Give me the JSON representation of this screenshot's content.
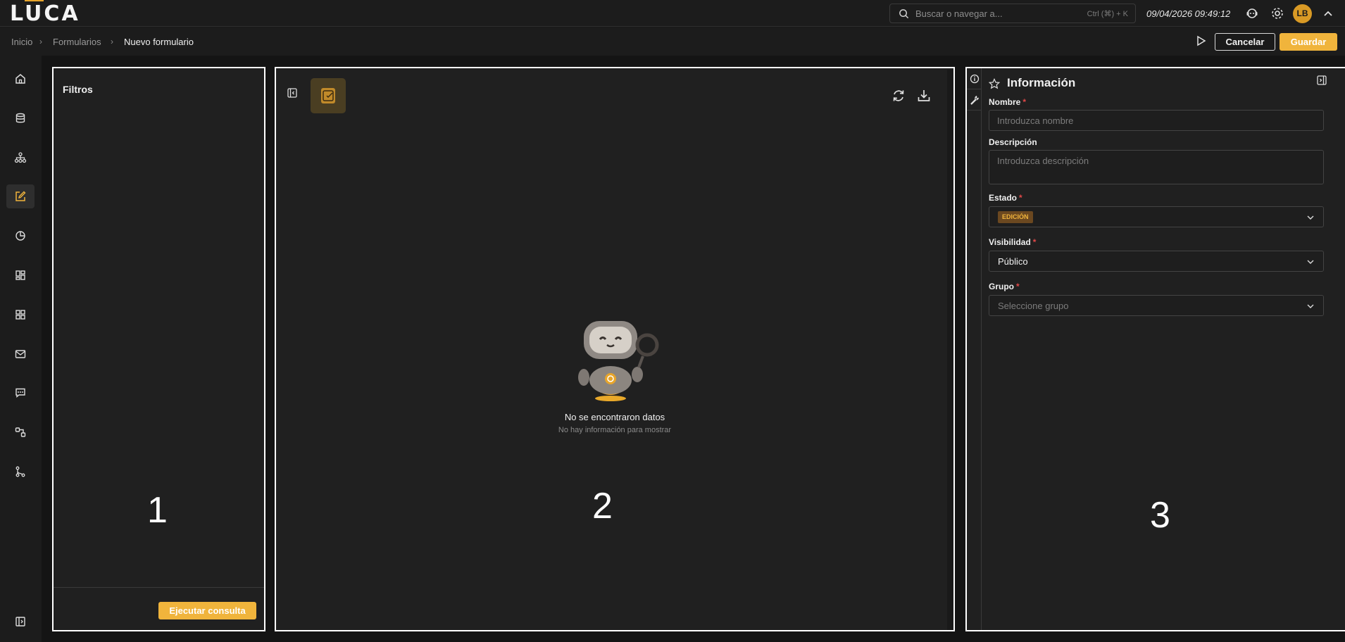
{
  "app": {
    "logo": "LUCA",
    "logo_accent_color": "#e7a52b"
  },
  "search": {
    "placeholder": "Buscar o navegar a...",
    "shortcut": "Ctrl (⌘) + K"
  },
  "header": {
    "datetime": "09/04/2026 09:49:12",
    "avatar_initials": "LB"
  },
  "breadcrumb": {
    "items": [
      "Inicio",
      "Formularios",
      "Nuevo formulario"
    ]
  },
  "actions": {
    "cancel": "Cancelar",
    "save": "Guardar"
  },
  "nav": {
    "icons": [
      "home-icon",
      "database-icon",
      "hierarchy-icon",
      "form-edit-icon",
      "pie-chart-icon",
      "dashboard-icon",
      "grid-icon",
      "mail-icon",
      "chat-icon",
      "workflow-icon",
      "git-branch-icon"
    ],
    "active": "form-edit-icon"
  },
  "filters": {
    "title": "Filtros",
    "run_button": "Ejecutar consulta",
    "panel_number": "1"
  },
  "results": {
    "empty_title": "No se encontraron datos",
    "empty_subtitle": "No hay información para mostrar",
    "panel_number": "2"
  },
  "info": {
    "title": "Información",
    "panel_number": "3",
    "name": {
      "label": "Nombre",
      "placeholder": "Introduzca nombre"
    },
    "description": {
      "label": "Descripción",
      "placeholder": "Introduzca descripción"
    },
    "state": {
      "label": "Estado",
      "value": "EDICIÓN"
    },
    "visibility": {
      "label": "Visibilidad",
      "value": "Público"
    },
    "group": {
      "label": "Grupo",
      "placeholder": "Seleccione grupo"
    }
  },
  "colors": {
    "accent": "#f0b43c",
    "required": "#e04848"
  }
}
